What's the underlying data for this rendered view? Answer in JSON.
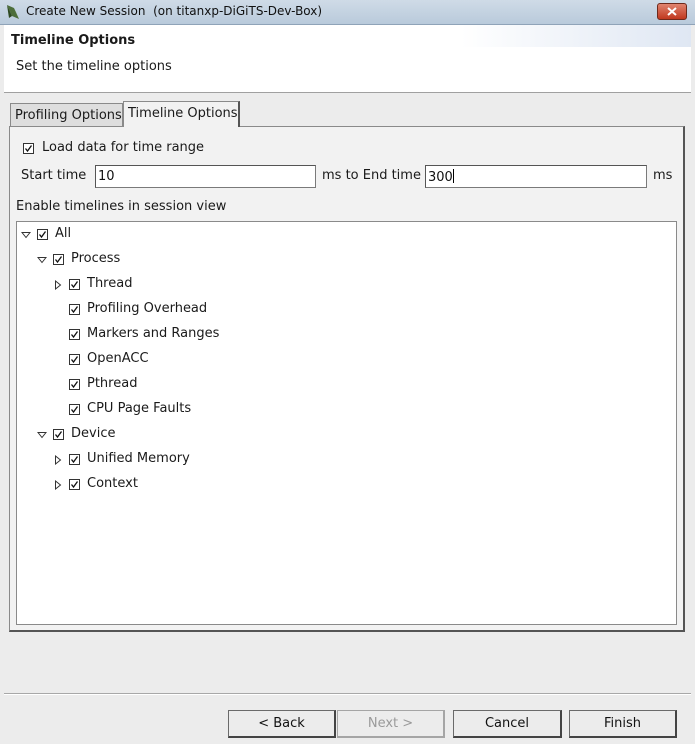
{
  "window": {
    "title": "Create New Session  (on titanxp-DiGiTS-Dev-Box)"
  },
  "header": {
    "title": "Timeline Options",
    "description": "Set the timeline options"
  },
  "tabs": [
    {
      "label": "Profiling Options",
      "active": false
    },
    {
      "label": "Timeline Options",
      "active": true
    }
  ],
  "time_range": {
    "load_label": "Load data for time range",
    "load_checked": true,
    "start_label": "Start time",
    "start_value": "10",
    "middle_label": "ms to End time",
    "end_value": "300",
    "unit_label": "ms"
  },
  "timelines": {
    "section_label": "Enable timelines in session view",
    "tree": [
      {
        "label": "All",
        "checked": true,
        "toggle": "expanded",
        "level": 0
      },
      {
        "label": "Process",
        "checked": true,
        "toggle": "expanded",
        "level": 1
      },
      {
        "label": "Thread",
        "checked": true,
        "toggle": "collapsed",
        "level": 2
      },
      {
        "label": "Profiling Overhead",
        "checked": true,
        "toggle": "none",
        "level": 2
      },
      {
        "label": "Markers and Ranges",
        "checked": true,
        "toggle": "none",
        "level": 2
      },
      {
        "label": "OpenACC",
        "checked": true,
        "toggle": "none",
        "level": 2
      },
      {
        "label": "Pthread",
        "checked": true,
        "toggle": "none",
        "level": 2
      },
      {
        "label": "CPU Page Faults",
        "checked": true,
        "toggle": "none",
        "level": 2
      },
      {
        "label": "Device",
        "checked": true,
        "toggle": "expanded",
        "level": 1
      },
      {
        "label": "Unified Memory",
        "checked": true,
        "toggle": "collapsed",
        "level": 2
      },
      {
        "label": "Context",
        "checked": true,
        "toggle": "collapsed",
        "level": 2
      }
    ]
  },
  "footer": {
    "back_label": "< Back",
    "next_label": "Next >",
    "cancel_label": "Cancel",
    "finish_label": "Finish",
    "next_enabled": false
  },
  "icons": {
    "app": "app-logo-icon",
    "close": "close-icon",
    "check": "check-icon",
    "expanded": "triangle-down-icon",
    "collapsed": "triangle-right-icon"
  },
  "colors": {
    "title_bar": "#b9cadb",
    "close_button": "#c0391f"
  }
}
